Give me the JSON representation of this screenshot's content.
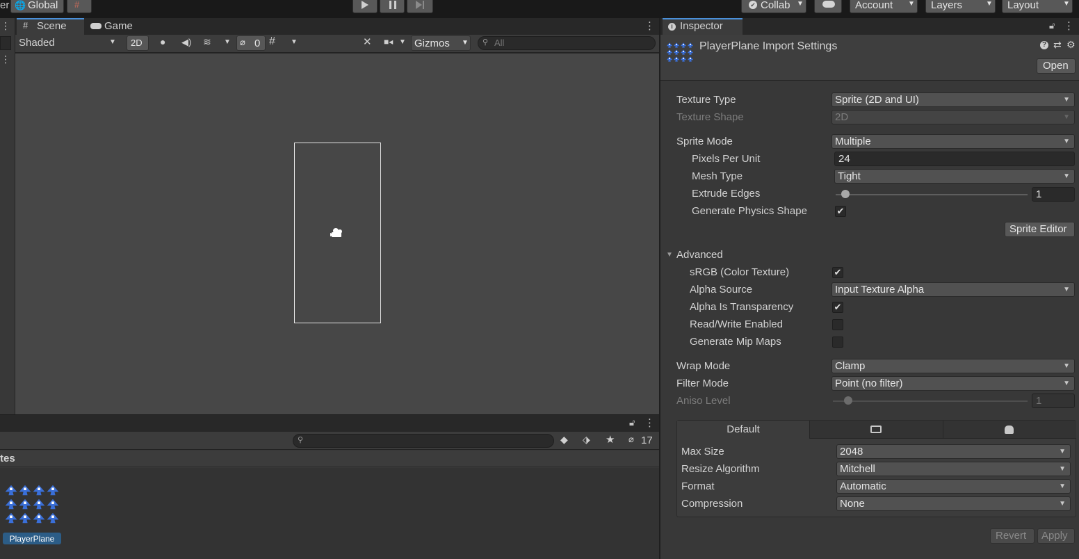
{
  "toolbar": {
    "left_stub": "er",
    "global_label": "Global",
    "collab_label": "Collab",
    "account_label": "Account",
    "layers_label": "Layers",
    "layout_label": "Layout"
  },
  "scene": {
    "tabs": [
      {
        "label": "Scene"
      },
      {
        "label": "Game"
      }
    ],
    "shading_mode": "Shaded",
    "btn_2d": "2D",
    "hidden_count": "0",
    "gizmos_label": "Gizmos",
    "search_placeholder": "All"
  },
  "project": {
    "hidden_count": "17",
    "breadcrumb_stub": "tes",
    "asset_name": "PlayerPlane"
  },
  "inspector": {
    "tab_label": "Inspector",
    "title": "PlayerPlane Import Settings",
    "open_label": "Open",
    "rows": {
      "texture_type": {
        "label": "Texture Type",
        "value": "Sprite (2D and UI)"
      },
      "texture_shape": {
        "label": "Texture Shape",
        "value": "2D"
      },
      "sprite_mode": {
        "label": "Sprite Mode",
        "value": "Multiple"
      },
      "pixels_per_unit": {
        "label": "Pixels Per Unit",
        "value": "24"
      },
      "mesh_type": {
        "label": "Mesh Type",
        "value": "Tight"
      },
      "extrude_edges": {
        "label": "Extrude Edges",
        "value": "1",
        "slider_fraction": 0.05
      },
      "generate_physics_shape": {
        "label": "Generate Physics Shape",
        "checked": true
      }
    },
    "sprite_editor_label": "Sprite Editor",
    "advanced": {
      "label": "Advanced",
      "srgb": {
        "label": "sRGB (Color Texture)",
        "checked": true
      },
      "alpha_source": {
        "label": "Alpha Source",
        "value": "Input Texture Alpha"
      },
      "alpha_is_transparency": {
        "label": "Alpha Is Transparency",
        "checked": true
      },
      "read_write": {
        "label": "Read/Write Enabled",
        "checked": false
      },
      "mip_maps": {
        "label": "Generate Mip Maps",
        "checked": false
      }
    },
    "wrap_mode": {
      "label": "Wrap Mode",
      "value": "Clamp"
    },
    "filter_mode": {
      "label": "Filter Mode",
      "value": "Point (no filter)"
    },
    "aniso_level": {
      "label": "Aniso Level",
      "value": "1",
      "slider_fraction": 0.08
    },
    "platform": {
      "default_tab": "Default",
      "max_size": {
        "label": "Max Size",
        "value": "2048"
      },
      "resize_algorithm": {
        "label": "Resize Algorithm",
        "value": "Mitchell"
      },
      "format": {
        "label": "Format",
        "value": "Automatic"
      },
      "compression": {
        "label": "Compression",
        "value": "None"
      }
    },
    "revert_label": "Revert",
    "apply_label": "Apply"
  },
  "colors": {
    "accent": "#2c5d87",
    "panel": "#383838",
    "scene_bg": "#474747",
    "sprite_blue": "#3a6fd8"
  }
}
